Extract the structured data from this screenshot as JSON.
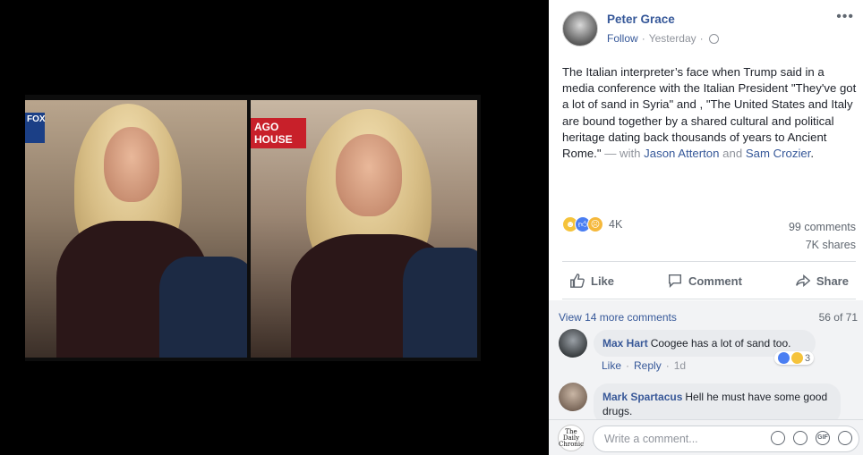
{
  "post": {
    "author": "Peter Grace",
    "follow_label": "Follow",
    "separator": "·",
    "timestamp": "Yesterday",
    "more_label": "•••",
    "text_main": "The Italian interpreter’s face when Trump said in a media conference with the Italian President \"They've got a lot of sand in Syria\" and , \"The United States and Italy are bound together by a shared cultural and political heritage dating back thousands of years to Ancient Rome.\"",
    "text_with": " — with ",
    "tag_1": "Jason Atterton",
    "text_and": " and ",
    "tag_2": "Sam Crozier",
    "text_end": ".",
    "reaction_count": "4K",
    "comments_count": "99 comments",
    "shares_count": "7K shares"
  },
  "image": {
    "left_logo": "FOX",
    "chyron_line1": "AGO",
    "chyron_line2": "HOUSE"
  },
  "actions": {
    "like": "Like",
    "comment": "Comment",
    "share": "Share"
  },
  "comments": {
    "view_more": "View 14 more comments",
    "position": "56 of 71",
    "items": [
      {
        "name": "Max Hart",
        "text": "Coogee has a lot of sand too.",
        "like": "Like",
        "reply": "Reply",
        "dot": "·",
        "time": "1d",
        "reactions": "3"
      },
      {
        "name": "Mark Spartacus",
        "text": "Hell he must have some good drugs."
      }
    ]
  },
  "composer": {
    "page_logo": "The Daily Chronic",
    "placeholder": "Write a comment...",
    "gif_label": "GIF"
  },
  "colors": {
    "link": "#365899",
    "name": "#385898",
    "muted": "#90949c",
    "reaction_like": "#4a7ef2",
    "reaction_haha": "#f5c33b"
  },
  "icons": [
    "globe-icon",
    "thumbs-up-icon",
    "comment-icon",
    "share-icon",
    "emoji-icon",
    "camera-icon",
    "gif-icon",
    "sticker-icon"
  ]
}
